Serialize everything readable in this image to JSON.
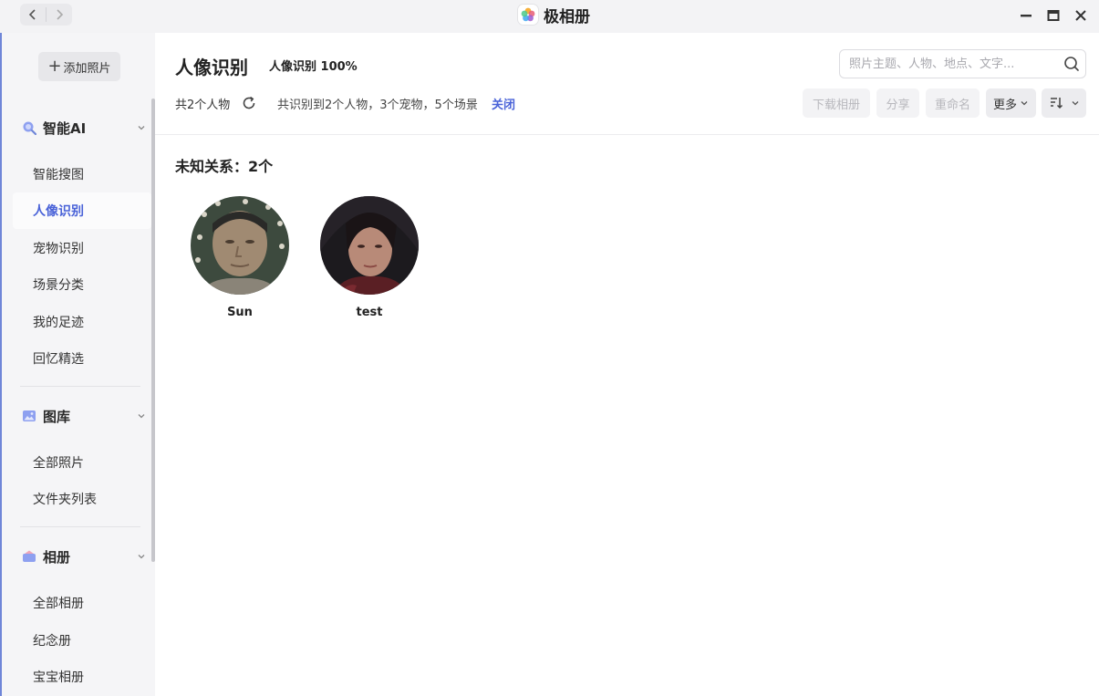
{
  "window": {
    "app_name": "极相册"
  },
  "sidebar": {
    "add_photo_label": "添加照片",
    "sections": [
      {
        "label": "智能AI",
        "items": [
          "智能搜图",
          "人像识别",
          "宠物识别",
          "场景分类",
          "我的足迹",
          "回忆精选"
        ]
      },
      {
        "label": "图库",
        "items": [
          "全部照片",
          "文件夹列表"
        ]
      },
      {
        "label": "相册",
        "items": [
          "全部相册",
          "纪念册",
          "宝宝相册"
        ]
      }
    ],
    "active_item": "人像识别"
  },
  "header": {
    "title": "人像识别",
    "progress": "人像识别 100%",
    "search_placeholder": "照片主题、人物、地点、文字...",
    "count_text": "共2个人物",
    "status_text": "共识别到2个人物，3个宠物，5个场景",
    "close_label": "关闭",
    "toolbar": {
      "download_label": "下载相册",
      "share_label": "分享",
      "rename_label": "重命名",
      "more_label": "更多"
    }
  },
  "content": {
    "group_title": "未知关系：2个",
    "people": [
      {
        "name": "Sun"
      },
      {
        "name": "test"
      }
    ]
  },
  "colors": {
    "accent": "#4a63d8",
    "sidebar_bg": "#f5f5f7",
    "titlebar_bg": "#f3f3f5"
  }
}
